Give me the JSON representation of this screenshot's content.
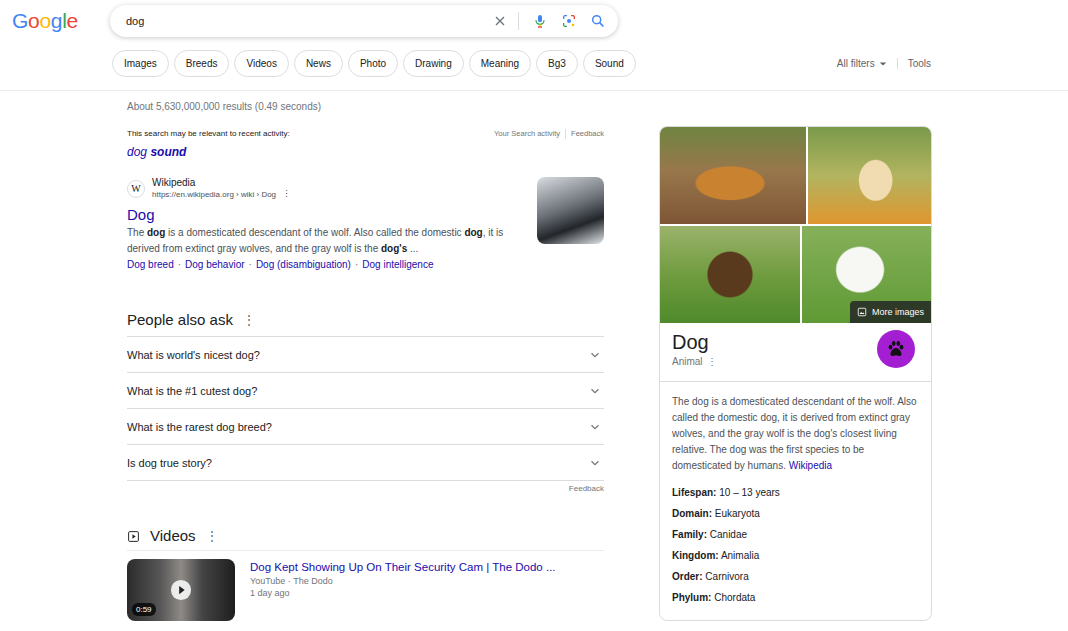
{
  "logo": "Google",
  "search": {
    "query": "dog"
  },
  "chips": [
    "Images",
    "Breeds",
    "Videos",
    "News",
    "Photo",
    "Drawing",
    "Meaning",
    "Bg3",
    "Sound"
  ],
  "filters": {
    "all_filters": "All filters",
    "tools": "Tools"
  },
  "result_stats": "About 5,630,000,000 results (0.49 seconds)",
  "recent_activity": {
    "label": "This search may be relevant to recent activity:",
    "links": [
      "Your Search activity",
      "Feedback"
    ],
    "suggestion": {
      "base": "dog",
      "bold": "sound"
    }
  },
  "results": [
    {
      "favicon": "W",
      "site": "Wikipedia",
      "url": "https://en.wikipedia.org › wiki › Dog",
      "menu": "⋮",
      "title": "Dog",
      "snippet": [
        {
          "text": "The ",
          "bold": false
        },
        {
          "text": "dog",
          "bold": true
        },
        {
          "text": " is a domesticated descendant of the wolf. Also called the domestic ",
          "bold": false
        },
        {
          "text": "dog",
          "bold": true
        },
        {
          "text": ", it is derived from extinct gray wolves, and the gray wolf is the ",
          "bold": false
        },
        {
          "text": "dog's",
          "bold": true
        },
        {
          "text": " ...",
          "bold": false
        }
      ],
      "separator": "·",
      "sitelinks": [
        "Dog breed",
        "Dog behavior",
        "Dog (disambiguation)",
        "Dog intelligence"
      ]
    }
  ],
  "people_also_ask": {
    "title": "People also ask",
    "menu": "⋮",
    "questions": [
      {
        "text": "What is world's nicest dog?",
        "expanded": false
      },
      {
        "text": "What is the #1 cutest dog?",
        "expanded": false
      },
      {
        "text": "What is the rarest dog breed?",
        "expanded": false
      },
      {
        "text": "Is dog true story?",
        "expanded": false
      }
    ],
    "feedback": "Feedback"
  },
  "videos": {
    "title": "Videos",
    "menu": "⋮",
    "items": [
      {
        "title": "Dog Kept Showing Up On Their Security Cam | The Dodo ...",
        "duration": "0:59",
        "meta": "YouTube · The Dodo",
        "age": "1 day ago"
      }
    ]
  },
  "knowledge_panel": {
    "more_images": "More images",
    "title": "Dog",
    "subtitle": "Animal",
    "menu": "⋮",
    "description": "The dog is a domesticated descendant of the wolf. Also called the domestic dog, it is derived from extinct gray wolves, and the gray wolf is the dog's closest living relative. The dog was the first species to be domesticated by humans.",
    "source": "Wikipedia",
    "facts": [
      {
        "label": "Lifespan:",
        "value": "10 – 13 years"
      },
      {
        "label": "Domain:",
        "value": "Eukaryota"
      },
      {
        "label": "Family:",
        "value": "Canidae"
      },
      {
        "label": "Kingdom:",
        "value": "Animalia"
      },
      {
        "label": "Order:",
        "value": "Carnivora"
      },
      {
        "label": "Phylum:",
        "value": "Chordata"
      }
    ]
  }
}
